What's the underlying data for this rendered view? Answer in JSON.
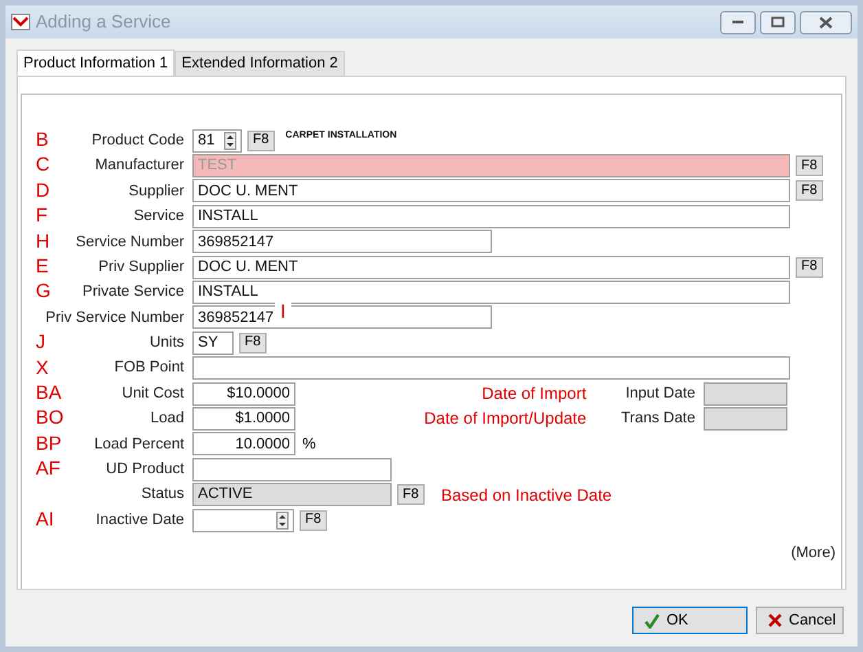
{
  "window": {
    "title": "Adding a Service"
  },
  "tabs": [
    {
      "label": "Product Information 1",
      "selected": true
    },
    {
      "label": "Extended Information 2",
      "selected": false
    }
  ],
  "rows": [
    {
      "annotation": "B",
      "label": "Product Code",
      "kind": "spin",
      "value": "81",
      "button": "F8",
      "note": "CARPET INSTALLATION"
    },
    {
      "annotation": "C",
      "label": "Manufacturer",
      "kind": "text",
      "value": "TEST",
      "highlighted": true,
      "button": "F8"
    },
    {
      "annotation": "D",
      "label": "Supplier",
      "kind": "text",
      "value": "DOC U. MENT",
      "button": "F8"
    },
    {
      "annotation": "F",
      "label": "Service",
      "kind": "text",
      "value": "INSTALL"
    },
    {
      "annotation": "H",
      "label": "Service Number",
      "kind": "text",
      "value": "369852147"
    },
    {
      "annotation": "E",
      "label": "Priv Supplier",
      "kind": "text",
      "value": "DOC U. MENT",
      "button": "F8"
    },
    {
      "annotation": "G",
      "label": "Private Service",
      "kind": "text",
      "value": "INSTALL"
    },
    {
      "label": "Priv Service  Number",
      "kind": "text",
      "value": "369852147",
      "side_annotation": "I"
    },
    {
      "annotation": "J",
      "label": "Units",
      "kind": "text",
      "value": "SY",
      "button": "F8"
    },
    {
      "annotation": "X",
      "label": "FOB Point",
      "kind": "text"
    },
    {
      "annotation": "BA",
      "label": "Unit Cost",
      "kind": "number",
      "value": "$10.0000",
      "red_note": "Date of Import",
      "side_field": {
        "label": "Input Date",
        "readonly": true
      }
    },
    {
      "annotation": "BO",
      "label": "Load",
      "kind": "number",
      "value": "$1.0000",
      "red_note": "Date of Import/Update",
      "side_field": {
        "label": "Trans Date",
        "readonly": true
      }
    },
    {
      "annotation": "BP",
      "label": "Load Percent",
      "kind": "number",
      "value": "10.0000",
      "suffix": "%"
    },
    {
      "annotation": "AF",
      "label": "UD Product",
      "kind": "text"
    },
    {
      "label": "Status",
      "kind": "text",
      "value": "ACTIVE",
      "readonly": true,
      "button": "F8",
      "red_note": "Based on Inactive Date"
    },
    {
      "annotation": "AI",
      "label": "Inactive Date",
      "kind": "spin",
      "button": "F8"
    }
  ],
  "more_link": "(More)",
  "buttons": [
    {
      "kind": "ok",
      "label": "OK",
      "selected": true
    },
    {
      "kind": "cancel",
      "label": "Cancel",
      "selected": false
    }
  ]
}
